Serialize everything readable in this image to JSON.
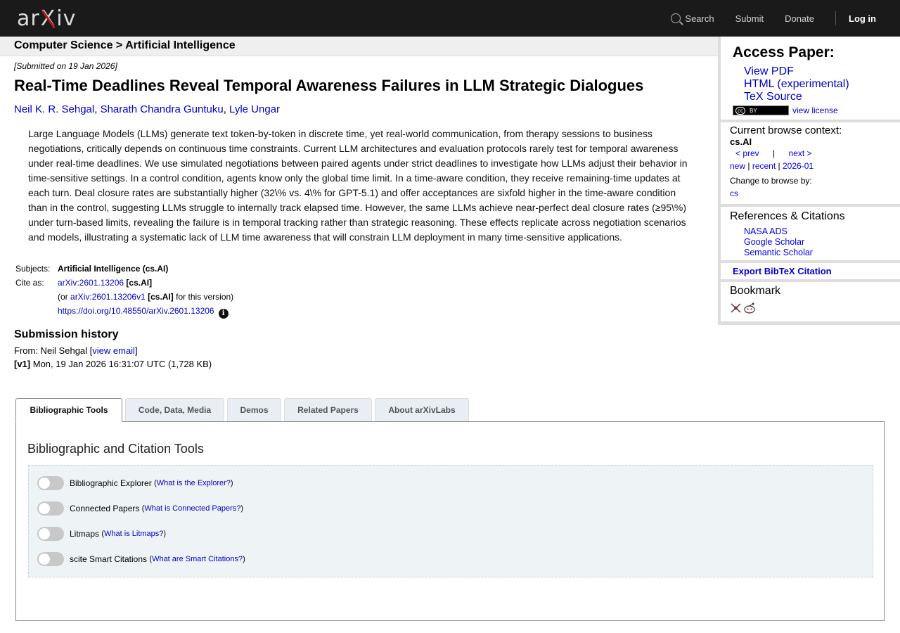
{
  "header": {
    "logo": {
      "left": "ar",
      "x": "X",
      "right": "iv"
    },
    "nav": {
      "search": "Search",
      "submit": "Submit",
      "donate": "Donate",
      "login": "Log in"
    }
  },
  "breadcrumb": "Computer Science > Artificial Intelligence",
  "paper": {
    "submitted": "[Submitted on 19 Jan 2026]",
    "title": "Real-Time Deadlines Reveal Temporal Awareness Failures in LLM Strategic Dialogues",
    "authors": [
      "Neil K. R. Sehgal",
      "Sharath Chandra Guntuku",
      "Lyle Ungar"
    ],
    "abstract": "Large Language Models (LLMs) generate text token-by-token in discrete time, yet real-world communication, from therapy sessions to business negotiations, critically depends on continuous time constraints. Current LLM architectures and evaluation protocols rarely test for temporal awareness under real-time deadlines. We use simulated negotiations between paired agents under strict deadlines to investigate how LLMs adjust their behavior in time-sensitive settings. In a control condition, agents know only the global time limit. In a time-aware condition, they receive remaining-time updates at each turn. Deal closure rates are substantially higher (32\\% vs. 4\\% for GPT-5.1) and offer acceptances are sixfold higher in the time-aware condition than in the control, suggesting LLMs struggle to internally track elapsed time. However, the same LLMs achieve near-perfect deal closure rates (≥95\\%) under turn-based limits, revealing the failure is in temporal tracking rather than strategic reasoning. These effects replicate across negotiation scenarios and models, illustrating a systematic lack of LLM time awareness that will constrain LLM deployment in many time-sensitive applications.",
    "subjects_label": "Subjects:",
    "subjects": "Artificial Intelligence (cs.AI)",
    "cite_label": "Cite as:",
    "cite_id": "arXiv:2601.13206",
    "cite_cat": "[cs.AI]",
    "cite_or": "(or",
    "cite_version": "arXiv:2601.13206v1",
    "cite_version_cat": "[cs.AI]",
    "cite_version_tail": "for this version)",
    "doi": "https://doi.org/10.48550/arXiv.2601.13206",
    "info_glyph": "i"
  },
  "history": {
    "title": "Submission history",
    "from_label": "From: Neil Sehgal [",
    "view_email": "view email",
    "from_tail": "]",
    "v1_label": "[v1]",
    "v1_text": "Mon, 19 Jan 2026 16:31:07 UTC (1,728 KB)"
  },
  "sidebar": {
    "access_title": "Access Paper:",
    "access_links": [
      "View PDF",
      "HTML (experimental)",
      "TeX Source"
    ],
    "license_badge": {
      "cc": "cc",
      "by": "BY"
    },
    "view_license": "view license",
    "context_title": "Current browse context:",
    "context": "cs.AI",
    "prev": "< prev",
    "pipe": "|",
    "next": "next >",
    "new": "new",
    "recent": "recent",
    "month": "2026-01",
    "sep": "|",
    "change_label": "Change to browse by:",
    "change_cat": "cs",
    "refs_title": "References & Citations",
    "refs": [
      "NASA ADS",
      "Google Scholar",
      "Semantic Scholar"
    ],
    "export": "Export BibTeX Citation",
    "bookmark_title": "Bookmark"
  },
  "tabs": [
    "Bibliographic Tools",
    "Code, Data, Media",
    "Demos",
    "Related Papers",
    "About arXivLabs"
  ],
  "panel": {
    "title": "Bibliographic and Citation Tools",
    "tools": [
      {
        "name": "Bibliographic Explorer",
        "help": "What is the Explorer?"
      },
      {
        "name": "Connected Papers",
        "help": "What is Connected Papers?"
      },
      {
        "name": "Litmaps",
        "help": "What is Litmaps?"
      },
      {
        "name": "scite Smart Citations",
        "help": "What are Smart Citations?"
      }
    ]
  }
}
